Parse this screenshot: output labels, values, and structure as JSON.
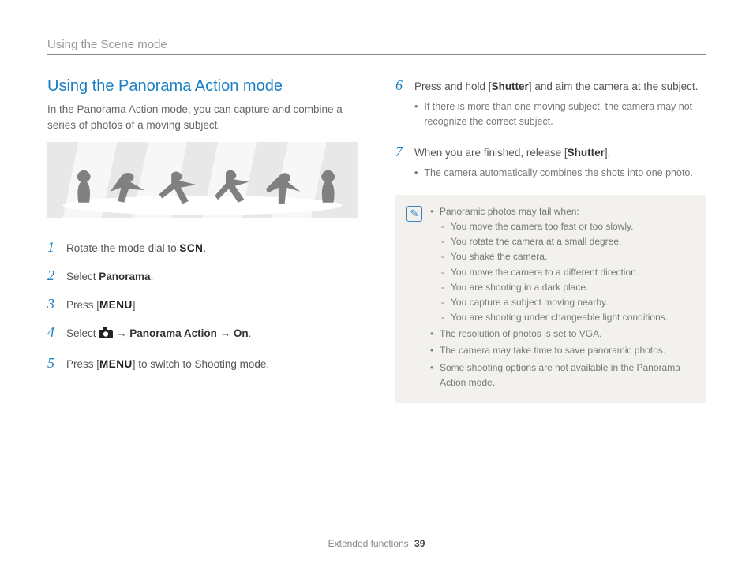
{
  "header": {
    "breadcrumb": "Using the Scene mode"
  },
  "left": {
    "title": "Using the Panorama Action mode",
    "intro": "In the Panorama Action mode, you can capture and combine a series of photos of a moving subject.",
    "steps": {
      "s1": {
        "num": "1",
        "pre": "Rotate the mode dial to ",
        "scn": "SCN",
        "post": "."
      },
      "s2": {
        "num": "2",
        "pre": "Select ",
        "bold": "Panorama",
        "post": "."
      },
      "s3": {
        "num": "3",
        "pre": "Press [",
        "menu": "MENU",
        "post": "]."
      },
      "s4": {
        "num": "4",
        "pre": "Select ",
        "arrow1": " → ",
        "b1": "Panorama Action",
        "arrow2": " → ",
        "b2": "On",
        "post": "."
      },
      "s5": {
        "num": "5",
        "pre": "Press [",
        "menu": "MENU",
        "post": "] to switch to Shooting mode."
      }
    }
  },
  "right": {
    "steps": {
      "s6": {
        "num": "6",
        "pre": "Press and hold [",
        "bold": "Shutter",
        "post": "] and aim the camera at the subject.",
        "sub": "If there is more than one moving subject, the camera may not recognize the correct subject."
      },
      "s7": {
        "num": "7",
        "pre": "When you are finished, release [",
        "bold": "Shutter",
        "post": "].",
        "sub": "The camera automatically combines the shots into one photo."
      }
    },
    "note": {
      "lead": "Panoramic photos may fail when:",
      "reasons": [
        "You move the camera too fast or too slowly.",
        "You rotate the camera at a small degree.",
        "You shake the camera.",
        "You move the camera to a different direction.",
        "You are shooting in a dark place.",
        "You capture a subject moving nearby.",
        "You are shooting under changeable light conditions."
      ],
      "extras": [
        "The resolution of photos is set to VGA.",
        "The camera may take time to save panoramic photos.",
        "Some shooting options are not available in the Panorama Action mode."
      ]
    }
  },
  "footer": {
    "section": "Extended functions",
    "page": "39"
  }
}
